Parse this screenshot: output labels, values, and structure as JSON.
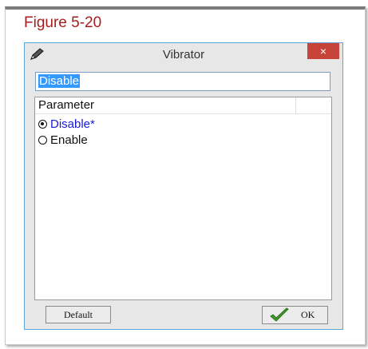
{
  "figure": {
    "title": "Figure 5-20"
  },
  "window": {
    "title": "Vibrator",
    "close_glyph": "×"
  },
  "value_field": {
    "value": "Disable"
  },
  "list": {
    "column_header": "Parameter",
    "options": [
      {
        "label": "Disable*",
        "selected": true
      },
      {
        "label": "Enable",
        "selected": false
      }
    ]
  },
  "buttons": {
    "default_label": "Default",
    "ok_label": "OK"
  },
  "colors": {
    "figure_title": "#a31f1f",
    "selected_option": "#1a1ad6",
    "close_button": "#c7443a",
    "check_icon": "#3f9b2a"
  },
  "icons": {
    "app": "pencil-icon",
    "ok": "checkmark-icon"
  }
}
